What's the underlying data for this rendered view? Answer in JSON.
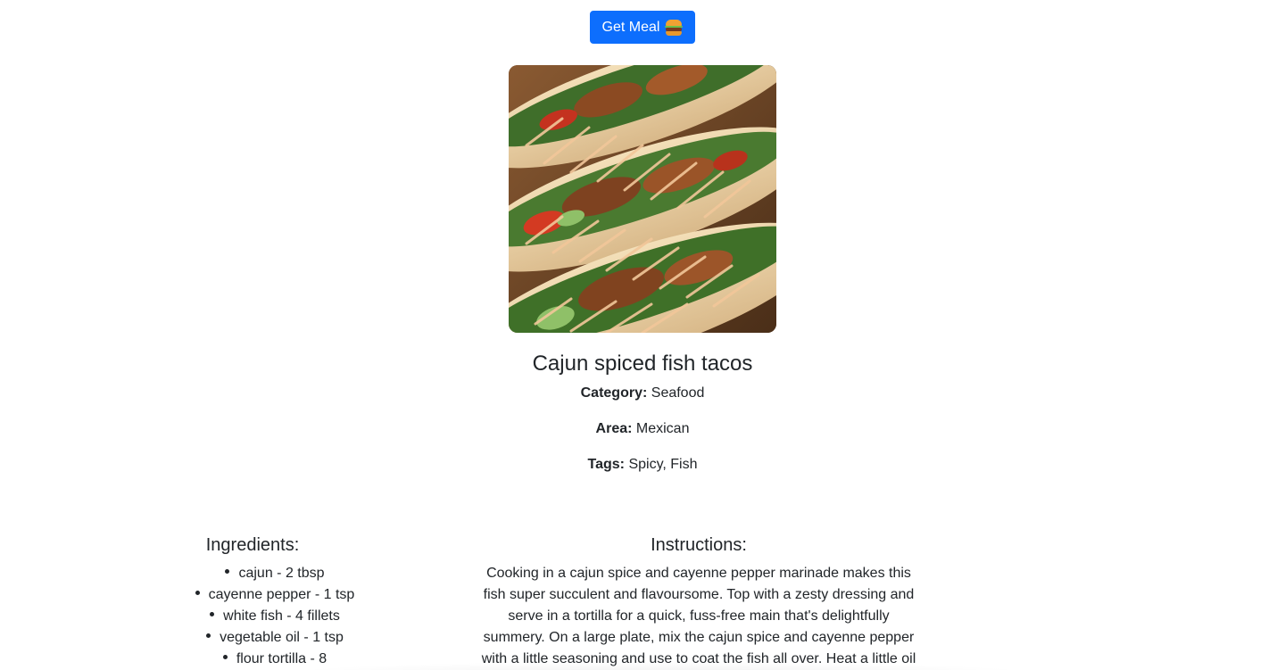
{
  "header": {
    "get_meal_label": "Get Meal",
    "get_meal_icon": "burger-icon"
  },
  "meal": {
    "title": "Cajun spiced fish tacos",
    "category_label": "Category:",
    "category_value": "Seafood",
    "area_label": "Area:",
    "area_value": "Mexican",
    "tags_label": "Tags:",
    "tags_value": "Spicy, Fish",
    "image_alt": "fish tacos photo"
  },
  "ingredients": {
    "heading": "Ingredients:",
    "items": [
      "cajun - 2 tbsp",
      "cayenne pepper - 1 tsp",
      "white fish - 4 fillets",
      "vegetable oil - 1 tsp",
      "flour tortilla - 8"
    ]
  },
  "instructions": {
    "heading": "Instructions:",
    "text": "Cooking in a cajun spice and cayenne pepper marinade makes this fish super succulent and flavoursome. Top with a zesty dressing and serve in a tortilla for a quick, fuss-free main that's delightfully summery. On a large plate, mix the cajun spice and cayenne pepper with a little seasoning and use to coat the fish all over. Heat a little oil"
  },
  "colors": {
    "primary": "#0d6efd",
    "text": "#212529",
    "background": "#ffffff"
  }
}
